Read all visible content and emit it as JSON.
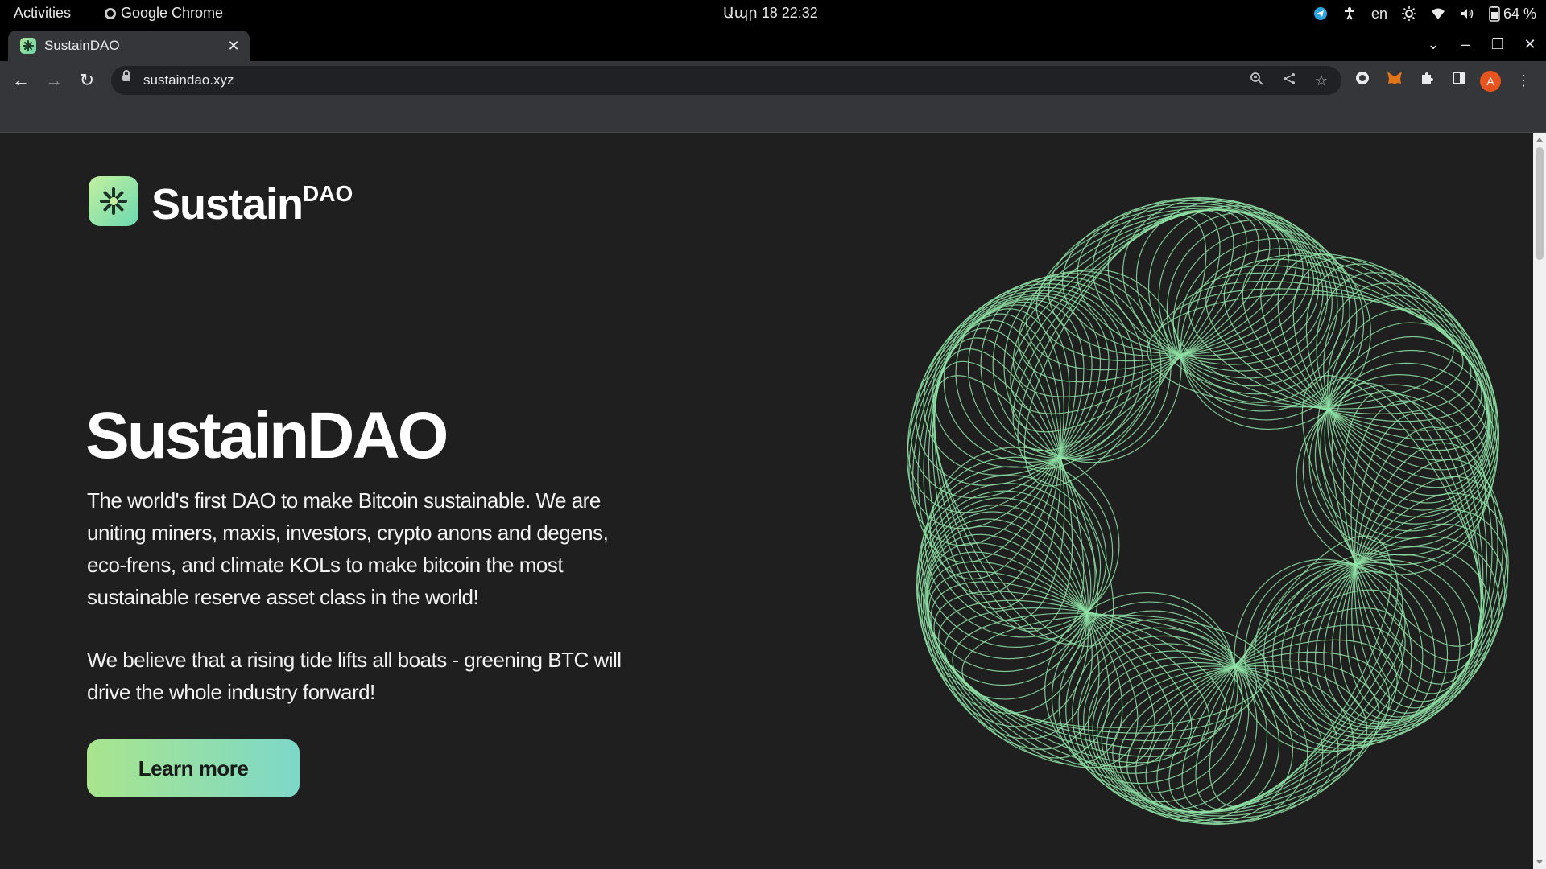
{
  "os": {
    "activities": "Activities",
    "app_name": "Google Chrome",
    "clock": "Ապր 18  22:32",
    "lang": "en",
    "battery": "64 %"
  },
  "browser": {
    "tab_title": "SustainDAO",
    "url": "sustaindao.xyz",
    "avatar_letter": "A"
  },
  "page": {
    "logo_word": "Sustain",
    "logo_sup": "DAO",
    "hero_title": "SustainDAO",
    "paragraph_1": "The world's first DAO to make Bitcoin sustainable. We are uniting miners, maxis, investors, crypto anons and degens, eco-frens, and climate KOLs to make bitcoin the most sustainable reserve asset class in the world!",
    "paragraph_2": "We believe that a rising tide lifts all boats - greening BTC will drive the whole industry forward!",
    "cta_label": "Learn more"
  },
  "colors": {
    "background": "#1f1f1f",
    "accent_green": "#a9e58d",
    "accent_teal": "#7dd8c8",
    "line_art": "#8fe3a6"
  }
}
